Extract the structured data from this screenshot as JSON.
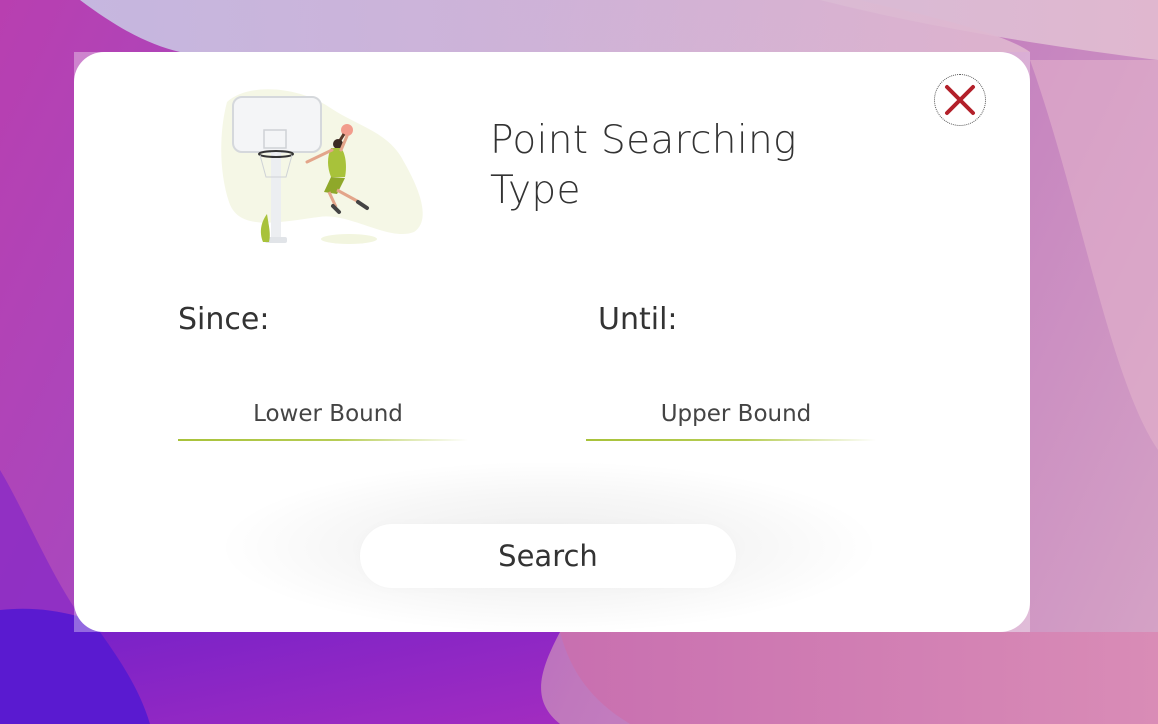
{
  "dialog": {
    "title": "Point Searching Type",
    "close_icon": "close-x-icon",
    "illustration": "basketball-player-dunk-illustration"
  },
  "form": {
    "since_label": "Since:",
    "until_label": "Until:",
    "lower_placeholder": "Lower Bound",
    "upper_placeholder": "Upper Bound",
    "search_label": "Search"
  },
  "colors": {
    "accent_green": "#a8c23a",
    "close_red": "#b3202a",
    "text": "#333333"
  }
}
